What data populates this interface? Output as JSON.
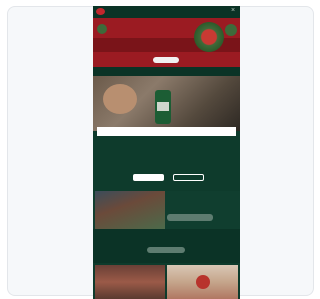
{
  "window": {
    "close_glyph": "×"
  },
  "hero": {
    "title": "",
    "button_label": ""
  },
  "age_gate": {
    "header": "",
    "question": "",
    "description": "",
    "yes_label": "",
    "no_label": "",
    "remember_label": ""
  },
  "section1": {
    "text": "",
    "button_label": ""
  },
  "section2": {
    "title": "",
    "button_label": ""
  },
  "colors": {
    "brand_green": "#0e3b2c",
    "brand_red": "#9b1b22",
    "text_light": "#c6d5cc",
    "button_muted": "#5e7c70"
  },
  "icons": {
    "logo": "logo-icon",
    "close": "close-icon"
  }
}
